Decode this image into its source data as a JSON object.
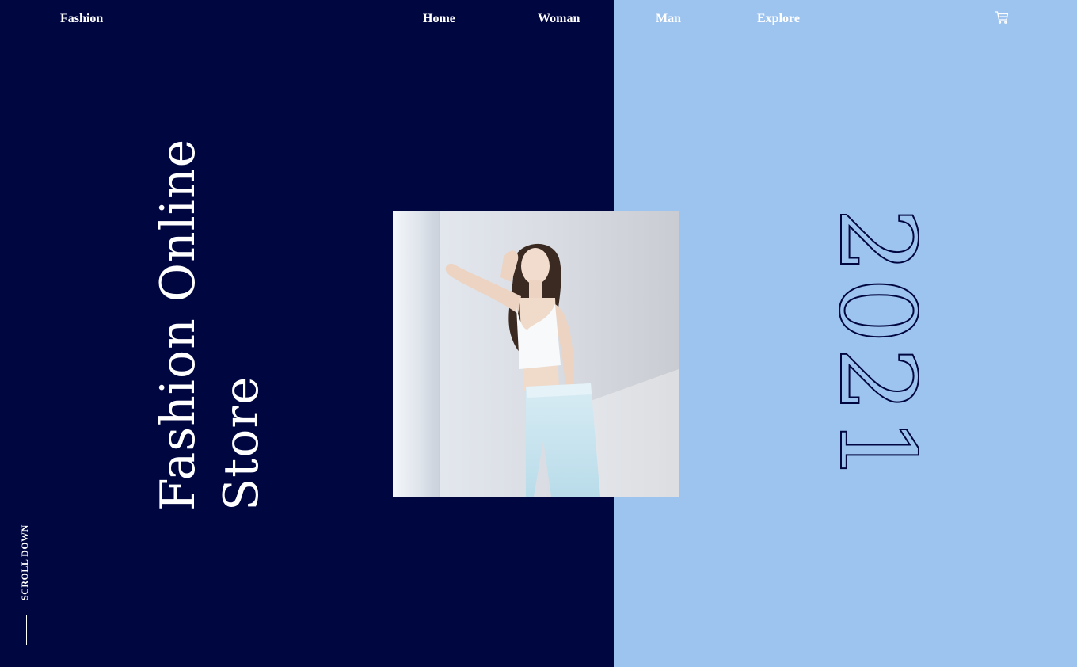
{
  "nav": {
    "brand": "Fashion",
    "links": [
      "Home",
      "Woman",
      "Man",
      "Explore"
    ],
    "cart_icon": "cart-icon"
  },
  "hero": {
    "title_line1": "Fashion Online",
    "title_line2": "Store",
    "year": "2021",
    "scroll_label": "SCROLL DOWN"
  },
  "colors": {
    "navy": "#000640",
    "light_blue": "#9dc3ef",
    "text": "#ffffff"
  }
}
